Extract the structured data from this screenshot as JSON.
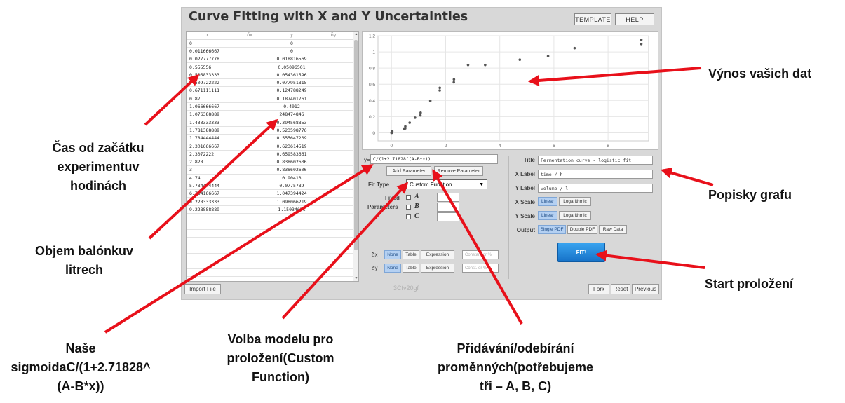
{
  "app": {
    "title": "Curve Fitting with X and Y Uncertainties",
    "template_label": "TEMPLATE",
    "help_label": "HELP"
  },
  "table": {
    "headers": [
      "x",
      "δx",
      "y",
      "δy"
    ],
    "rows": [
      {
        "x": "0",
        "y": "0"
      },
      {
        "x": "0.011666667",
        "y": "0"
      },
      {
        "x": "0.027777778",
        "y": "0.018816569"
      },
      {
        "x": "0.555556",
        "y": "0.05096501"
      },
      {
        "x": "0.505833333",
        "y": "0.054361596"
      },
      {
        "x": "0.509722222",
        "y": "0.077951815"
      },
      {
        "x": "0.671111111",
        "y": "0.124788249"
      },
      {
        "x": "0.87",
        "y": "0.187401761"
      },
      {
        "x": "1.066666667",
        "y": "0.4012"
      },
      {
        "x": "1.076388889",
        "y": "248474846"
      },
      {
        "x": "1.433333333",
        "y": "0.394568853"
      },
      {
        "x": "1.781388889",
        "y": "0.523598776"
      },
      {
        "x": "1.784444444",
        "y": "0.555647209"
      },
      {
        "x": "2.301666667",
        "y": "0.623614519"
      },
      {
        "x": "2.3072222",
        "y": "0.659583661"
      },
      {
        "x": "2.828",
        "y": "0.838602606"
      },
      {
        "x": "3",
        "y": "0.838602606"
      },
      {
        "x": "4.74",
        "y": "0.90413"
      },
      {
        "x": "5.784444444",
        "y": "0.0775789"
      },
      {
        "x": "6.764166667",
        "y": "1.047394424"
      },
      {
        "x": "9.228333333",
        "y": "1.098066219"
      },
      {
        "x": "9.228888889",
        "y": "1.15034651"
      },
      {
        "x": "",
        "y": ""
      },
      {
        "x": "",
        "y": ""
      },
      {
        "x": "",
        "y": ""
      },
      {
        "x": "",
        "y": ""
      },
      {
        "x": "",
        "y": ""
      },
      {
        "x": "",
        "y": ""
      },
      {
        "x": "",
        "y": ""
      },
      {
        "x": "",
        "y": ""
      },
      {
        "x": "",
        "y": ""
      }
    ]
  },
  "chart_data": {
    "type": "scatter",
    "xlim": [
      -0.5,
      9.5
    ],
    "ylim": [
      -0.1,
      1.2
    ],
    "x_ticks": [
      0,
      2,
      4,
      6,
      8
    ],
    "y_ticks": [
      0,
      0.2,
      0.4,
      0.6,
      0.8,
      1,
      1.2
    ],
    "grid": true,
    "series": [
      {
        "x": [
          0,
          0.0117,
          0.0278,
          0.46,
          0.506,
          0.51,
          0.671,
          0.87,
          1.067,
          1.076,
          1.433,
          1.781,
          1.784,
          2.302,
          2.307,
          2.828,
          3.46,
          4.74,
          5.784,
          6.764,
          9.228,
          9.229
        ],
        "y": [
          0,
          0,
          0.019,
          0.051,
          0.054,
          0.078,
          0.125,
          0.187,
          0.216,
          0.248,
          0.395,
          0.524,
          0.556,
          0.624,
          0.66,
          0.839,
          0.839,
          0.904,
          0.948,
          1.047,
          1.098,
          1.15
        ]
      }
    ]
  },
  "fit": {
    "equation_prefix": "y=",
    "equation": "C/(1+2.71828^(A-B*x))",
    "add_parameter_label": "Add Parameter",
    "remove_parameter_label": "Remove Parameter",
    "fit_type_label": "Fit Type",
    "fit_type_value": "Custom Function",
    "fixed_label_1": "Fixed",
    "fixed_label_2": "Parameters",
    "parameters": [
      "A",
      "B",
      "C"
    ]
  },
  "uncertainty": {
    "dx_label": "δx",
    "dy_label": "δy",
    "options": [
      "None",
      "Table",
      "Expression"
    ],
    "dx_placeholder": "Constant or %",
    "dy_placeholder": "Const. or %"
  },
  "settings": {
    "title_label": "Title",
    "title_value": "Fermentation curve - logistic fit",
    "xlabel_label": "X Label",
    "xlabel_value": "time / h",
    "ylabel_label": "Y Label",
    "ylabel_value": "volume / l",
    "xscale_label": "X Scale",
    "yscale_label": "Y Scale",
    "scale_options": [
      "Linear",
      "Logarithmic"
    ],
    "output_label": "Output",
    "output_options": [
      "Single PDF",
      "Double PDF",
      "Raw Data"
    ],
    "fit_button": "FIT!"
  },
  "footer": {
    "import_label": "Import File",
    "hash": "3Cfv20gf",
    "fork_label": "Fork",
    "reset_label": "Reset",
    "previous_label": "Previous"
  },
  "annotations": {
    "vynos": "Výnos vašich dat",
    "cas_1": "Čas od začátku",
    "cas_2": "experimentuv",
    "cas_3": "hodinách",
    "objem_1": "Objem balónkuv",
    "objem_2": "litrech",
    "popisky": "Popisky grafu",
    "start": "Start proložení",
    "nase_1": "Naše",
    "nase_2": "sigmoidaC/(1+2.71828^",
    "nase_3": "(A-B*x))",
    "volba_1": "Volba modelu pro",
    "volba_2": "proložení(Custom",
    "volba_3": "Function)",
    "prid_1": "Přidávání/odebírání",
    "prid_2": "proměnných(potřebujeme",
    "prid_3": "tři – A, B, C)"
  },
  "colors": {
    "arrow": "#e8101a",
    "point": "#555555",
    "accent_button": "#1e88d8"
  }
}
